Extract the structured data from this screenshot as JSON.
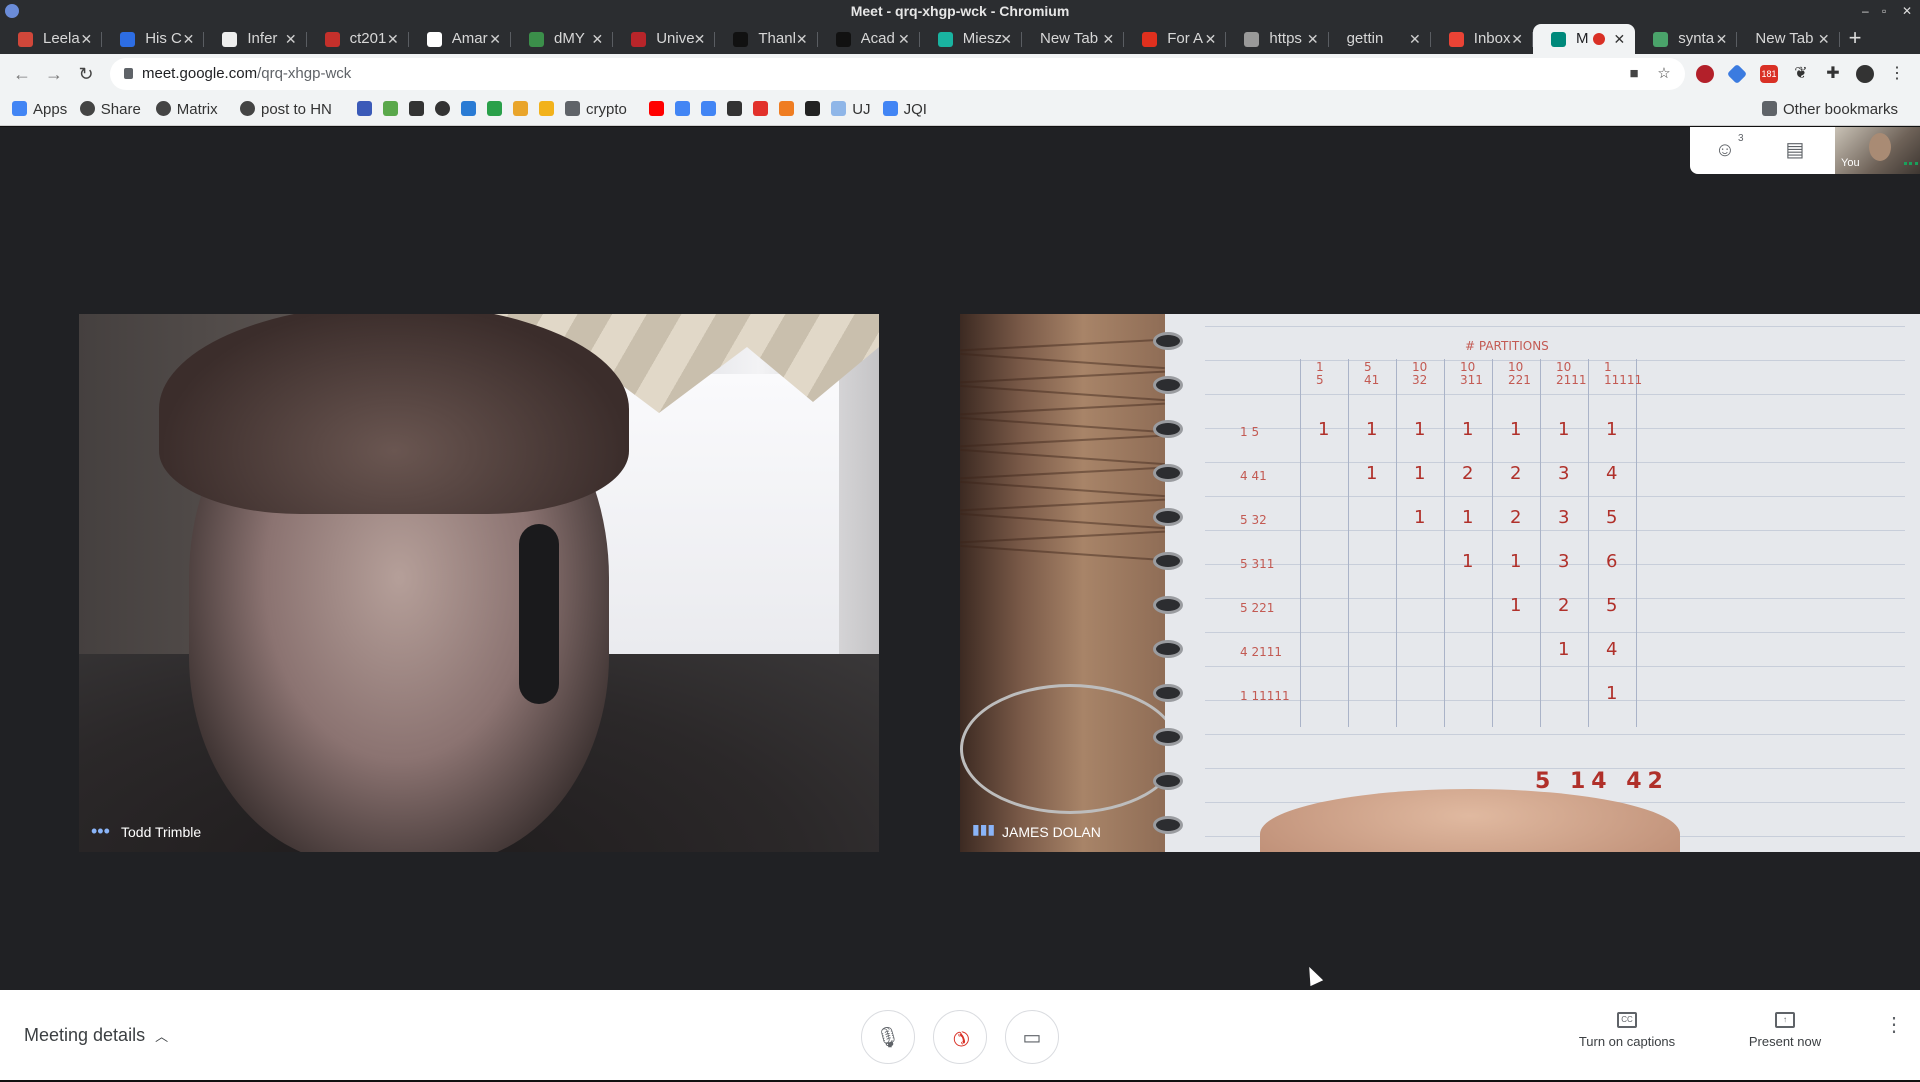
{
  "window": {
    "title": "Meet - qrq-xhgp-wck - Chromium"
  },
  "tabs": [
    {
      "label": "Leela",
      "icon": "lichess-icon",
      "color": "#d0473a"
    },
    {
      "label": "His C",
      "icon": "dropbox-icon",
      "color": "#2d6de3"
    },
    {
      "label": "Infer",
      "icon": "wikipedia-icon",
      "color": "#eeeeee"
    },
    {
      "label": "ct201",
      "icon": "pdf-icon",
      "color": "#c4302b"
    },
    {
      "label": "Amar",
      "icon": "amazon-icon",
      "color": "#ffffff"
    },
    {
      "label": "dMY",
      "icon": "chart-icon",
      "color": "#3b8f4a"
    },
    {
      "label": "Unive",
      "icon": "university-shield-icon",
      "color": "#b8252a"
    },
    {
      "label": "Thanl",
      "icon": "mask-icon",
      "color": "#111111"
    },
    {
      "label": "Acad",
      "icon": "mask-icon",
      "color": "#111111"
    },
    {
      "label": "Miesz",
      "icon": "circle-icon",
      "color": "#19b3a0"
    },
    {
      "label": "New Tab",
      "icon": "",
      "color": ""
    },
    {
      "label": "For A",
      "icon": "tomato-icon",
      "color": "#e0301e"
    },
    {
      "label": "https",
      "icon": "globe-icon",
      "color": "#999999"
    },
    {
      "label": "gettin",
      "icon": "",
      "color": ""
    },
    {
      "label": "Inbox",
      "icon": "gmail-icon",
      "color": "#ea4335"
    },
    {
      "label": "M",
      "icon": "meet-icon",
      "color": "#00897b",
      "active": true
    },
    {
      "label": "synta",
      "icon": "gear-icon",
      "color": "#4aa36a"
    },
    {
      "label": "New Tab",
      "icon": "",
      "color": ""
    }
  ],
  "toolbar": {
    "url_host": "meet.google.com",
    "url_path": "/qrq-xhgp-wck",
    "badge_count": "181"
  },
  "bookmarks": [
    {
      "label": "Apps",
      "icon": "apps-grid-icon",
      "color": "#4285f4"
    },
    {
      "label": "Share",
      "icon": "globe-icon",
      "color": "#444444"
    },
    {
      "label": "Matrix",
      "icon": "globe-icon",
      "color": "#444444"
    },
    {
      "label": "post to HN",
      "icon": "globe-icon",
      "color": "#444444"
    },
    {
      "label": "",
      "icon": "bitcoin-icon",
      "color": "#3b5ab8"
    },
    {
      "label": "",
      "icon": "leaf-icon",
      "color": "#5aa84b"
    },
    {
      "label": "",
      "icon": "car-icon",
      "color": "#333333"
    },
    {
      "label": "",
      "icon": "globe-icon",
      "color": "#333333"
    },
    {
      "label": "",
      "icon": "vscode-icon",
      "color": "#2a7bd4"
    },
    {
      "label": "",
      "icon": "b-icon",
      "color": "#2aa04a"
    },
    {
      "label": "",
      "icon": "square-icon",
      "color": "#e9a52b"
    },
    {
      "label": "",
      "icon": "wave-icon",
      "color": "#f2b21b"
    },
    {
      "label": "crypto",
      "icon": "folder-icon",
      "color": "#5f6368"
    },
    {
      "label": "",
      "icon": "youtube-icon",
      "color": "#ff0000"
    },
    {
      "label": "",
      "icon": "calendar-icon",
      "color": "#4285f4"
    },
    {
      "label": "",
      "icon": "diamond-icon",
      "color": "#4285f4"
    },
    {
      "label": "",
      "icon": "film-icon",
      "color": "#333333"
    },
    {
      "label": "",
      "icon": "c-icon",
      "color": "#e2312b"
    },
    {
      "label": "",
      "icon": "ring-icon",
      "color": "#ef7d22"
    },
    {
      "label": "",
      "icon": "mk-icon",
      "color": "#222222"
    },
    {
      "label": "UJ",
      "icon": "image-icon",
      "color": "#8fb6e8"
    },
    {
      "label": "JQI",
      "icon": "doc-icon",
      "color": "#4285f4"
    }
  ],
  "other_bookmarks": "Other bookmarks",
  "meet": {
    "participant_count": "3",
    "self_label": "You",
    "participants": [
      {
        "name": "Todd Trimble"
      },
      {
        "name": "JAMES DOLAN"
      }
    ],
    "meeting_details_label": "Meeting details",
    "captions_label": "Turn on captions",
    "present_label": "Present now"
  },
  "whiteboard": {
    "header": "# PARTITIONS",
    "col_heads": [
      "1\n5",
      "5\n41",
      "10\n32",
      "10\n311",
      "10\n221",
      "10\n2111",
      "1\n11111"
    ],
    "row_heads": [
      "1 5",
      "4 41",
      "5 32",
      "5 311",
      "5 221",
      "4 2111",
      "1 11111"
    ],
    "rows": [
      [
        "1",
        "1",
        "1",
        "1",
        "1",
        "1",
        "1"
      ],
      [
        "",
        "1",
        "1",
        "2",
        "2",
        "3",
        "4"
      ],
      [
        "",
        "",
        "1",
        "1",
        "2",
        "3",
        "5"
      ],
      [
        "",
        "",
        "",
        "1",
        "1",
        "3",
        "6"
      ],
      [
        "",
        "",
        "",
        "",
        "1",
        "2",
        "5"
      ],
      [
        "",
        "",
        "",
        "",
        "",
        "1",
        "4"
      ],
      [
        "",
        "",
        "",
        "",
        "",
        "",
        "1"
      ]
    ],
    "footer": "5  14  42"
  }
}
